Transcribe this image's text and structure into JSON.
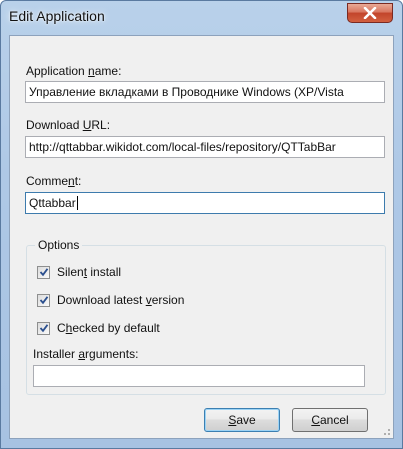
{
  "window": {
    "title": "Edit Application",
    "close_glyph": "close-icon"
  },
  "fields": {
    "app_name": {
      "label_pre": "Application ",
      "label_key": "n",
      "label_post": "ame:",
      "value": "Управление вкладками в Проводнике Windows (XP/Vista"
    },
    "download_url": {
      "label_pre": "Download ",
      "label_key": "U",
      "label_post": "RL:",
      "value": "http://qttabbar.wikidot.com/local-files/repository/QTTabBar"
    },
    "comment": {
      "label_pre": "Comme",
      "label_key": "n",
      "label_post": "t:",
      "value": "Qttabbar"
    }
  },
  "options": {
    "title": "Options",
    "checkboxes": [
      {
        "pre": "Silen",
        "key": "t",
        "post": " install",
        "checked": true
      },
      {
        "pre": "Download latest ",
        "key": "v",
        "post": "ersion",
        "checked": true
      },
      {
        "pre": "C",
        "key": "h",
        "post": "ecked by default",
        "checked": true
      }
    ],
    "installer_args": {
      "label_pre": "Installer ",
      "label_key": "a",
      "label_post": "rguments:",
      "value": ""
    }
  },
  "buttons": {
    "save": {
      "key": "S",
      "post": "ave"
    },
    "cancel": {
      "key": "C",
      "post": "ancel"
    }
  },
  "colors": {
    "accent": "#3d7bad",
    "close_red": "#c2452b",
    "check_blue": "#2b4f8e"
  }
}
